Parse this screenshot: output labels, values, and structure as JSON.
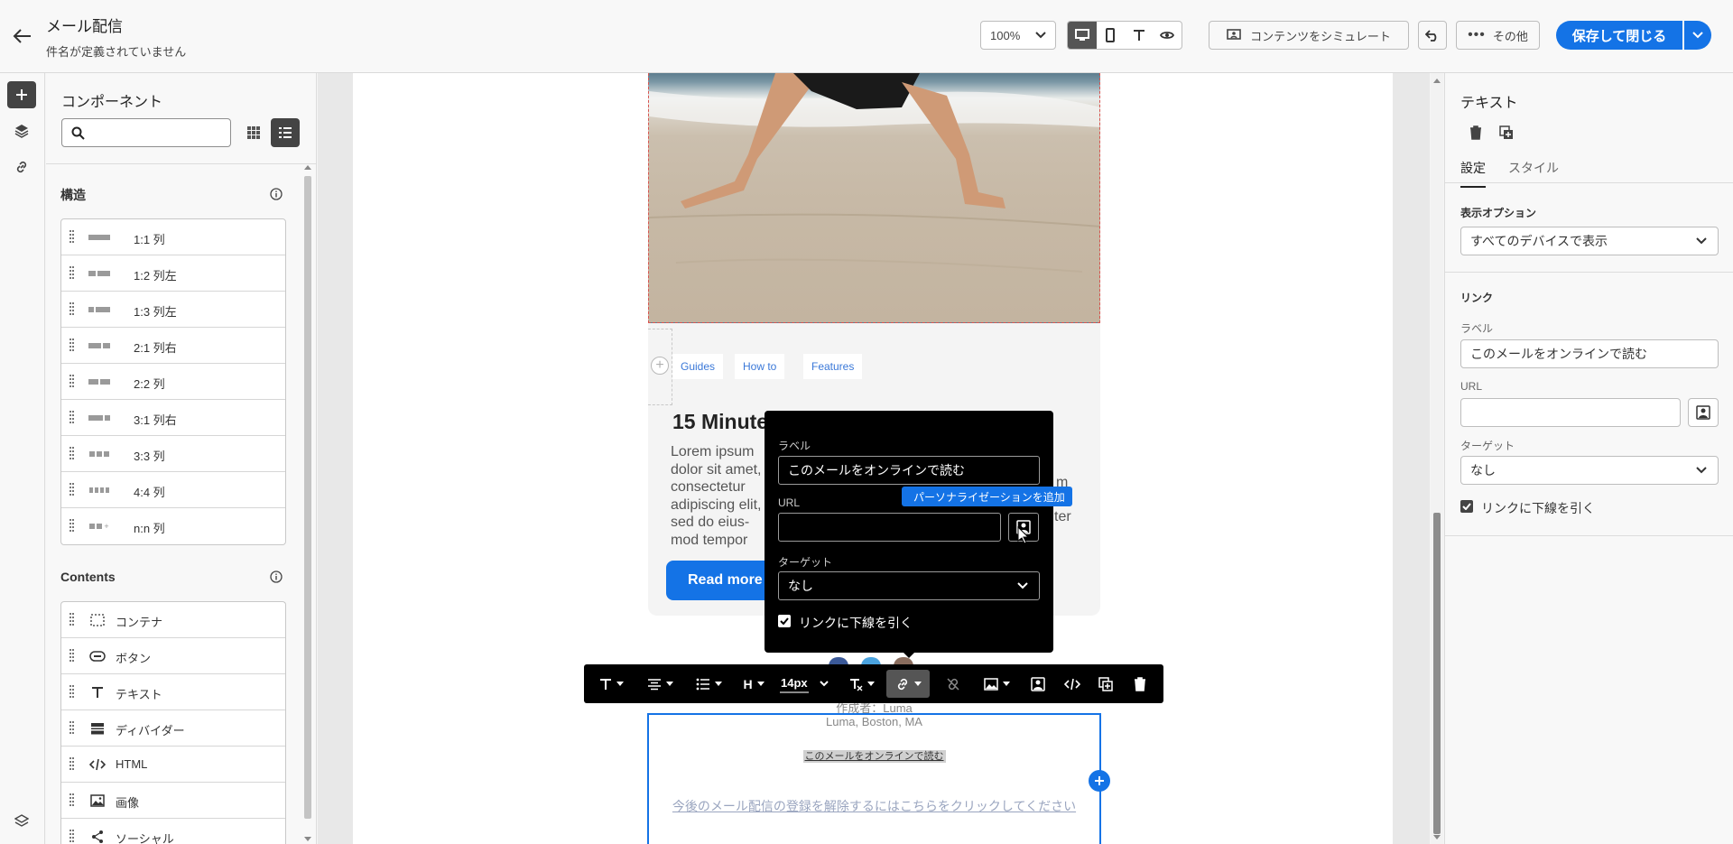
{
  "header": {
    "title": "メール配信",
    "subtitle": "件名が定義されていません",
    "zoom": "100%",
    "simulate_label": "コンテンツをシミュレート",
    "more_label": "その他",
    "save_label": "保存して閉じる"
  },
  "components": {
    "title": "コンポーネント",
    "search_placeholder": "",
    "structure_title": "構造",
    "structure_items": [
      {
        "label": "1:1 列"
      },
      {
        "label": "1:2 列左"
      },
      {
        "label": "1:3 列左"
      },
      {
        "label": "2:1 列右"
      },
      {
        "label": "2:2 列"
      },
      {
        "label": "3:1 列右"
      },
      {
        "label": "3:3 列"
      },
      {
        "label": "4:4 列"
      },
      {
        "label": "n:n 列"
      }
    ],
    "contents_title": "Contents",
    "contents_items": [
      {
        "label": "コンテナ",
        "icon": "container-icon"
      },
      {
        "label": "ボタン",
        "icon": "button-icon"
      },
      {
        "label": "テキスト",
        "icon": "text-icon"
      },
      {
        "label": "ディバイダー",
        "icon": "divider-icon"
      },
      {
        "label": "HTML",
        "icon": "code-icon"
      },
      {
        "label": "画像",
        "icon": "image-icon"
      },
      {
        "label": "ソーシャル",
        "icon": "share-icon"
      }
    ]
  },
  "email": {
    "tags": [
      "Guides",
      "How to",
      "Features"
    ],
    "heading": "15 Minute",
    "body_lines": [
      "Lorem ipsum",
      "dolor sit amet,",
      "consectetur",
      "adipiscing elit,",
      "sed do eius-",
      "mod tempor"
    ],
    "right_frag_1": "m",
    "right_frag_2": "ter",
    "button_label": "Read more",
    "footer_author": "作成者：Luma",
    "footer_address": "Luma, Boston, MA",
    "online_link": "このメールをオンラインで読む",
    "unsubscribe": "今後のメール配信の登録を解除するにはこちらをクリックしてください"
  },
  "popover": {
    "label_title": "ラベル",
    "label_value": "このメールをオンラインで読む",
    "url_title": "URL",
    "url_value": "",
    "target_title": "ターゲット",
    "target_value": "なし",
    "underline_label": "リンクに下線を引く",
    "underline_checked": true,
    "tooltip": "パーソナライゼーションを追加"
  },
  "toolbar": {
    "heading_label": "H",
    "font_size": "14px"
  },
  "right_panel": {
    "title": "テキスト",
    "tab_settings": "設定",
    "tab_style": "スタイル",
    "display_options_title": "表示オプション",
    "display_options_value": "すべてのデバイスで表示",
    "link_title": "リンク",
    "label_title": "ラベル",
    "label_value": "このメールをオンラインで読む",
    "url_title": "URL",
    "url_value": "",
    "target_title": "ターゲット",
    "target_value": "なし",
    "underline_label": "リンクに下線を引く"
  },
  "colors": {
    "accent": "#1473e6",
    "link": "#3a78d8",
    "popover_bg": "#000000"
  }
}
